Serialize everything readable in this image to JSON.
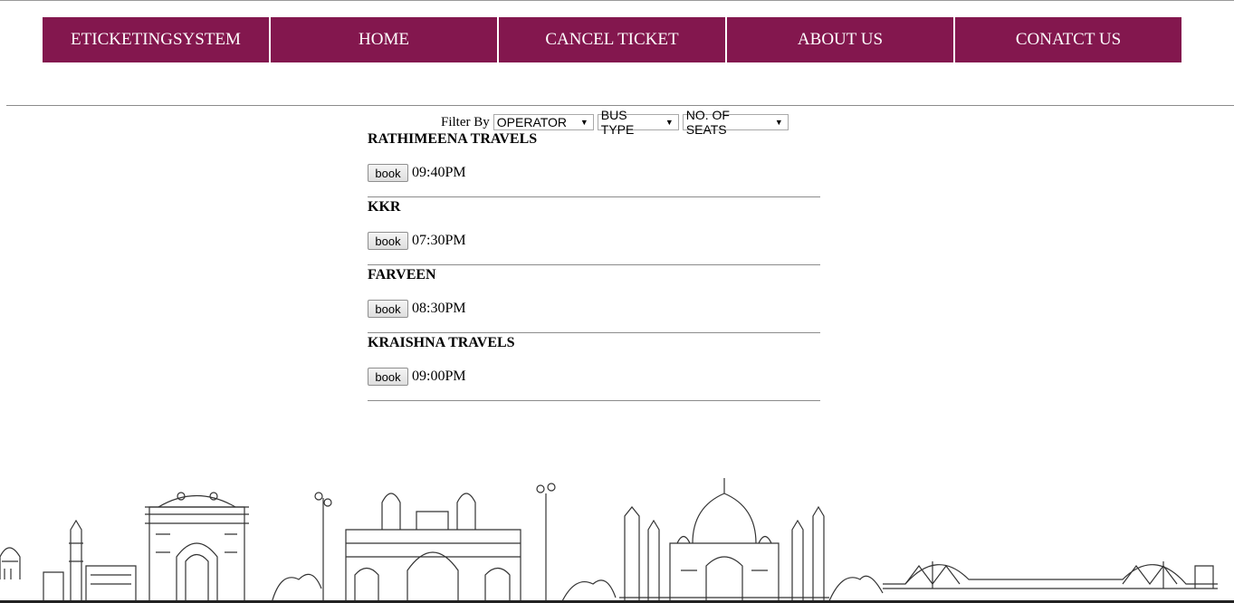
{
  "nav": {
    "items": [
      {
        "label": "ETICKETINGSYSTEM"
      },
      {
        "label": "HOME"
      },
      {
        "label": "CANCEL TICKET"
      },
      {
        "label": "ABOUT US"
      },
      {
        "label": "CONATCT US"
      }
    ],
    "color": "#83174e"
  },
  "filter": {
    "label": "Filter By",
    "operator": "OPERATOR",
    "bus_type": "BUS TYPE",
    "seats": "NO. OF SEATS"
  },
  "buses": [
    {
      "name": "RATHIMEENA TRAVELS",
      "book_label": "book",
      "time": "09:40PM"
    },
    {
      "name": "KKR",
      "book_label": "book",
      "time": "07:30PM"
    },
    {
      "name": "FARVEEN",
      "book_label": "book",
      "time": "08:30PM"
    },
    {
      "name": "KRAISHNA TRAVELS",
      "book_label": "book",
      "time": "09:00PM"
    }
  ],
  "icons": {
    "select_caret": "caret-down-icon",
    "footer": "city-skyline-illustration"
  }
}
